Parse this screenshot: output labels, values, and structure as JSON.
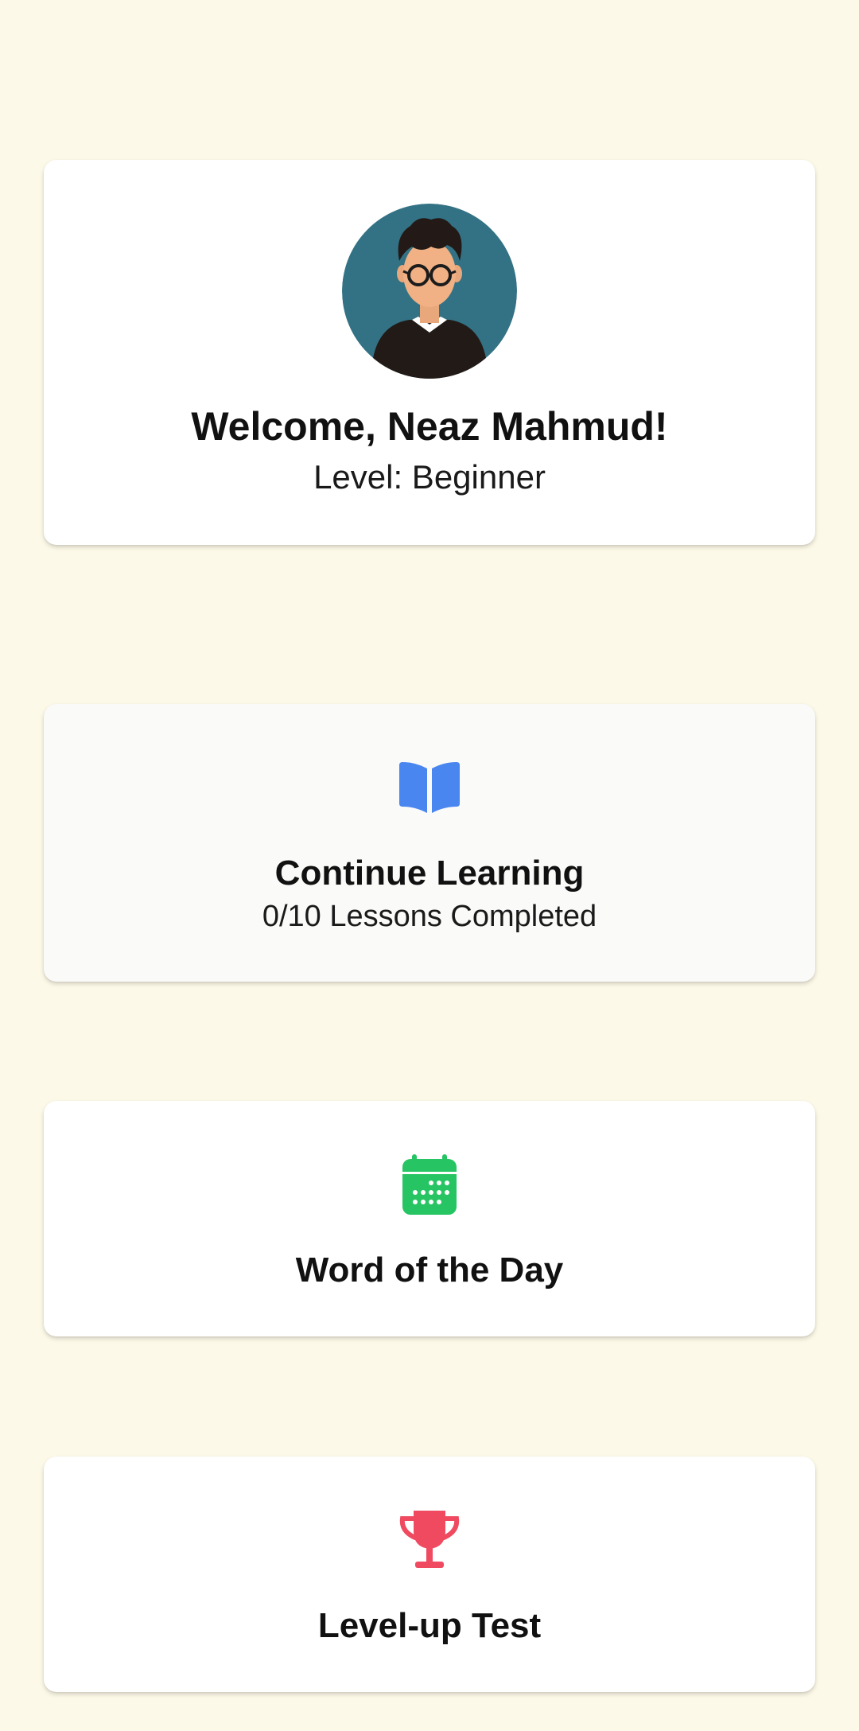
{
  "profile": {
    "welcome": "Welcome, Neaz Mahmud!",
    "level": "Level: Beginner",
    "avatar_icon": "user-avatar-icon"
  },
  "cards": {
    "continue": {
      "title": "Continue Learning",
      "subtitle": "0/10 Lessons Completed",
      "icon": "open-book-icon",
      "icon_color": "#4a86f0"
    },
    "word": {
      "title": "Word of the Day",
      "icon": "calendar-icon",
      "icon_color": "#27c463"
    },
    "levelup": {
      "title": "Level-up Test",
      "icon": "trophy-icon",
      "icon_color": "#ef4a60"
    }
  },
  "colors": {
    "background": "#fdf9e8",
    "avatar_bg": "#337284"
  }
}
